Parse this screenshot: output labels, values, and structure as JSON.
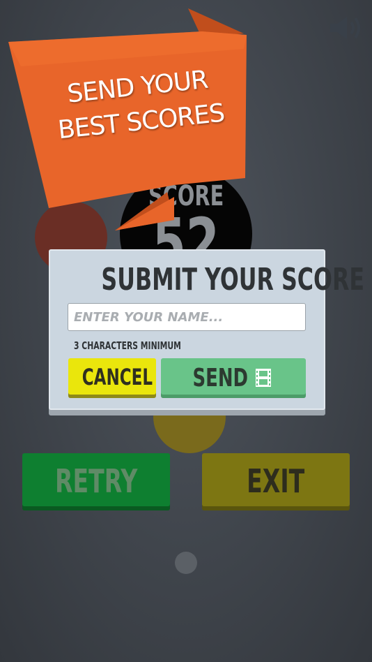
{
  "banner": {
    "line1": "SEND YOUR",
    "line2": "BEST SCORES"
  },
  "score": {
    "label": "SCORE",
    "value": "52"
  },
  "dialog": {
    "title": "SUBMIT YOUR SCORE",
    "name_placeholder": "ENTER YOUR NAME...",
    "name_value": "",
    "hint": "3 CHARACTERS MINIMUM",
    "cancel_label": "CANCEL",
    "send_label": "SEND"
  },
  "buttons": {
    "retry_label": "RETRY",
    "exit_label": "EXIT"
  },
  "icons": {
    "sound": "speaker-icon",
    "send": "film-icon"
  },
  "colors": {
    "background": "#43484f",
    "banner": "#e8652a",
    "dialog": "#cbd6e0",
    "cancel": "#eae60c",
    "send": "#69c489",
    "retry": "#0e7f30",
    "exit": "#7d7612"
  }
}
